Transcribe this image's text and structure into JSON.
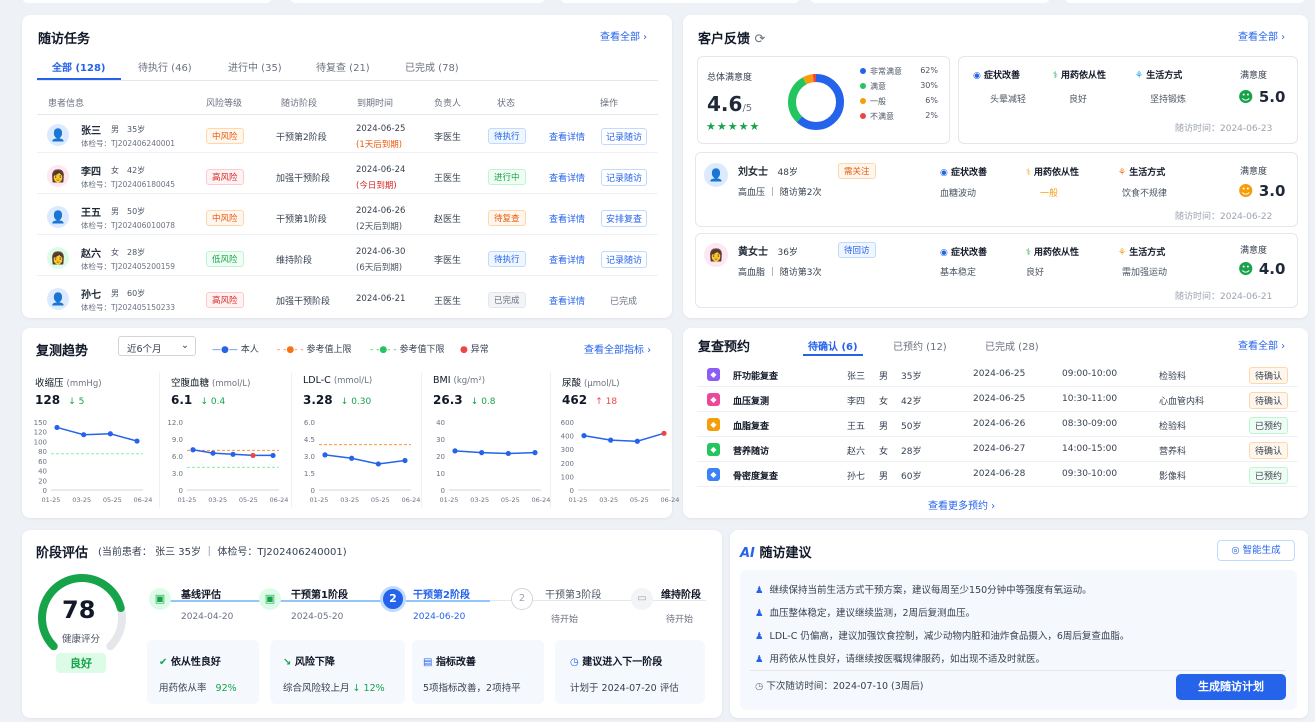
{
  "followup": {
    "title": "随访任务",
    "view_all": "查看全部",
    "tabs": [
      "全部 (128)",
      "待执行 (46)",
      "进行中 (35)",
      "待复查 (21)",
      "已完成 (78)"
    ],
    "headers": [
      "患者信息",
      "风险等级",
      "随访阶段",
      "到期时间",
      "负责人",
      "状态",
      "操作"
    ],
    "rows": [
      {
        "name": "张三",
        "sex": "男",
        "age": "35岁",
        "id": "体检号：TJ202406240001",
        "risk": "中风险",
        "stage": "干预第2阶段",
        "due": "2024-06-25",
        "due_note": "(1天后到期)",
        "owner": "李医生",
        "status": "待执行",
        "action1": "查看详情",
        "action2": "记录随访"
      },
      {
        "name": "李四",
        "sex": "女",
        "age": "42岁",
        "id": "体检号：TJ202406180045",
        "risk": "高风险",
        "stage": "加强干预阶段",
        "due": "2024-06-24",
        "due_note": "(今日到期)",
        "owner": "王医生",
        "status": "进行中",
        "action1": "查看详情",
        "action2": "记录随访"
      },
      {
        "name": "王五",
        "sex": "男",
        "age": "50岁",
        "id": "体检号：TJ202406010078",
        "risk": "中风险",
        "stage": "干预第1阶段",
        "due": "2024-06-26",
        "due_note": "(2天后到期)",
        "owner": "赵医生",
        "status": "待复查",
        "action1": "查看详情",
        "action2": "安排复查"
      },
      {
        "name": "赵六",
        "sex": "女",
        "age": "28岁",
        "id": "体检号：TJ202405200159",
        "risk": "低风险",
        "stage": "维持阶段",
        "due": "2024-06-30",
        "due_note": "(6天后到期)",
        "owner": "李医生",
        "status": "待执行",
        "action1": "查看详情",
        "action2": "记录随访"
      },
      {
        "name": "孙七",
        "sex": "男",
        "age": "60岁",
        "id": "体检号：TJ202405150233",
        "risk": "高风险",
        "stage": "加强干预阶段",
        "due": "2024-06-21",
        "due_note": "",
        "owner": "王医生",
        "status": "已完成",
        "action1": "查看详情",
        "action2": "已完成"
      }
    ]
  },
  "feedback": {
    "title": "客户反馈",
    "view_all": "查看全部",
    "overall_label": "总体满意度",
    "score": "4.6",
    "score_of": "/5",
    "stars": "★★★★★",
    "legend": [
      {
        "label": "非常满意",
        "value": "62%",
        "color": "#2563eb"
      },
      {
        "label": "满意",
        "value": "30%",
        "color": "#22c55e"
      },
      {
        "label": "一般",
        "value": "6%",
        "color": "#f59e0b"
      },
      {
        "label": "不满意",
        "value": "2%",
        "color": "#ef4444"
      }
    ],
    "donut": [
      62,
      30,
      6,
      2
    ],
    "top": {
      "c1": "症状改善",
      "c1v": "头晕减轻",
      "c2": "用药依从性",
      "c2v": "良好",
      "c3": "生活方式",
      "c3v": "坚持锻炼",
      "sat_label": "满意度",
      "sat": "5.0",
      "time": "随访时间：2024-06-23"
    },
    "people": [
      {
        "name": "刘女士",
        "age": "48岁",
        "tag": "需关注",
        "info": "高血压 ｜ 随访第2次",
        "c1": "症状改善",
        "c1v": "血糖波动",
        "c2": "用药依从性",
        "c2v": "一般",
        "c3": "生活方式",
        "c3v": "饮食不规律",
        "sat_label": "满意度",
        "sat": "3.0",
        "time": "随访时间：2024-06-22"
      },
      {
        "name": "黄女士",
        "age": "36岁",
        "tag": "待回访",
        "info": "高血脂 ｜ 随访第3次",
        "c1": "症状改善",
        "c1v": "基本稳定",
        "c2": "用药依从性",
        "c2v": "良好",
        "c3": "生活方式",
        "c3v": "需加强运动",
        "sat_label": "满意度",
        "sat": "4.0",
        "time": "随访时间：2024-06-21"
      }
    ]
  },
  "trend": {
    "title": "复测趋势",
    "range": "近6个月",
    "legend_self": "本人",
    "legend_upper": "参考值上限",
    "legend_lower": "参考值下限",
    "legend_abn": "异常",
    "view_all": "查看全部指标"
  },
  "chart_data": [
    {
      "type": "line",
      "title": "收缩压",
      "unit": "(mmHg)",
      "value": "128",
      "delta": "↓ 5",
      "x": [
        "01-25",
        "03-25",
        "05-25",
        "06-24"
      ],
      "y": [
        138,
        122,
        124,
        108
      ],
      "ref_lines": [
        80
      ],
      "ylim": [
        0,
        150
      ],
      "yticks": [
        "150",
        "120",
        "100",
        "80",
        "60",
        "40",
        "20",
        "0"
      ]
    },
    {
      "type": "line",
      "title": "空腹血糖",
      "unit": "(mmol/L)",
      "value": "6.1",
      "delta": "↓ 0.4",
      "x": [
        "01-25",
        "03-25",
        "05-25",
        "06-24"
      ],
      "y": [
        7.1,
        6.5,
        6.3,
        6.1,
        6.1
      ],
      "ref_lines": [
        7.0,
        4.0
      ],
      "ylim": [
        0,
        12
      ],
      "yticks": [
        "12.0",
        "9.0",
        "6.0",
        "3.0",
        "0"
      ]
    },
    {
      "type": "line",
      "title": "LDL-C",
      "unit": "(mmol/L)",
      "value": "3.28",
      "delta": "↓ 0.30",
      "x": [
        "01-25",
        "03-25",
        "05-25",
        "06-24"
      ],
      "y": [
        3.1,
        2.8,
        2.3,
        2.6
      ],
      "ref_lines": [
        4.0
      ],
      "ylim": [
        0,
        6
      ],
      "yticks": [
        "6.0",
        "4.5",
        "3.0",
        "1.5",
        "0"
      ]
    },
    {
      "type": "line",
      "title": "BMI",
      "unit": "(kg/m²)",
      "value": "26.3",
      "delta": "↓ 0.8",
      "x": [
        "01-25",
        "03-25",
        "05-25",
        "06-24"
      ],
      "y": [
        23,
        22,
        21.5,
        22
      ],
      "ref_lines": [],
      "ylim": [
        0,
        40
      ],
      "yticks": [
        "40",
        "30",
        "20",
        "10",
        "0"
      ]
    },
    {
      "type": "line",
      "title": "尿酸",
      "unit": "(μmol/L)",
      "value": "462",
      "delta": "↑ 18",
      "x": [
        "01-25",
        "03-25",
        "05-25",
        "06-24"
      ],
      "y": [
        480,
        440,
        430,
        500
      ],
      "ref_lines": [],
      "ylim": [
        0,
        600
      ],
      "yticks": [
        "600",
        "400",
        "300",
        "200",
        "100",
        "0"
      ]
    }
  ],
  "appointments": {
    "title": "复查预约",
    "view_all": "查看全部",
    "tabs": [
      "待确认 (6)",
      "已预约 (12)",
      "已完成 (28)"
    ],
    "more": "查看更多预约",
    "rows": [
      {
        "item": "肝功能复查",
        "name": "张三",
        "sex": "男",
        "age": "35岁",
        "date": "2024-06-25",
        "time": "09:00-10:00",
        "dept": "检验科",
        "status": "待确认",
        "color": "#8b5cf6"
      },
      {
        "item": "血压复测",
        "name": "李四",
        "sex": "女",
        "age": "42岁",
        "date": "2024-06-25",
        "time": "10:30-11:00",
        "dept": "心血管内科",
        "status": "待确认",
        "color": "#ec4899"
      },
      {
        "item": "血脂复查",
        "name": "王五",
        "sex": "男",
        "age": "50岁",
        "date": "2024-06-26",
        "time": "08:30-09:00",
        "dept": "检验科",
        "status": "已预约",
        "color": "#f59e0b"
      },
      {
        "item": "营养随访",
        "name": "赵六",
        "sex": "女",
        "age": "28岁",
        "date": "2024-06-27",
        "time": "14:00-15:00",
        "dept": "营养科",
        "status": "待确认",
        "color": "#22c55e"
      },
      {
        "item": "骨密度复查",
        "name": "孙七",
        "sex": "男",
        "age": "60岁",
        "date": "2024-06-28",
        "time": "09:30-10:00",
        "dept": "影像科",
        "status": "已预约",
        "color": "#3b82f6"
      }
    ]
  },
  "stage": {
    "title": "阶段评估",
    "patient": "(当前患者：  张三    35岁  ｜  体检号：TJ202406240001)",
    "gauge_value": "78",
    "gauge_label": "健康评分",
    "gauge_fraction": 0.78,
    "grade": "良好",
    "steps": [
      {
        "label": "基线评估",
        "sub": "2024-04-20"
      },
      {
        "label": "干预第1阶段",
        "sub": "2024-05-20"
      },
      {
        "label": "干预第2阶段",
        "sub": "2024-06-20"
      },
      {
        "label": "干预第3阶段",
        "sub": "待开始"
      },
      {
        "label": "维持阶段",
        "sub": "待开始"
      }
    ],
    "step_num_current": "2",
    "step_num_next": "2",
    "boxes": [
      {
        "title": "依从性良好",
        "sub": "用药依从率",
        "val": "92%"
      },
      {
        "title": "风险下降",
        "sub": "综合风险较上月",
        "val": "↓ 12%"
      },
      {
        "title": "指标改善",
        "sub": "5项指标改善，2项持平",
        "val": ""
      },
      {
        "title": "建议进入下一阶段",
        "sub": "计划于 2024-07-20 评估",
        "val": ""
      }
    ]
  },
  "ai": {
    "badge": "AI",
    "title": "随访建议",
    "gen_btn": "智能生成",
    "suggestions": [
      "继续保持当前生活方式干预方案，建议每周至少150分钟中等强度有氧运动。",
      "血压整体稳定，建议继续监测，2周后复测血压。",
      "LDL-C 仍偏高，建议加强饮食控制，减少动物内脏和油炸食品摄入，6周后复查血脂。",
      "用药依从性良好，请继续按医嘱规律服药，如出现不适及时就医。"
    ],
    "next_visit": "下次随访时间：2024-07-10 (3周后)",
    "plan_btn": "生成随访计划"
  }
}
